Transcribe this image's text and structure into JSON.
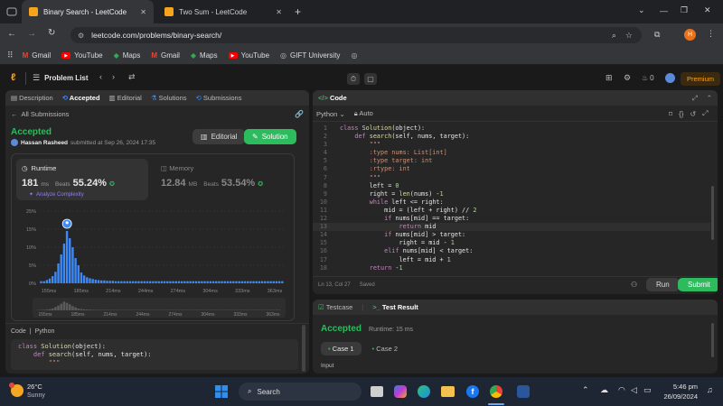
{
  "browser": {
    "tabs": [
      {
        "title": "Binary Search - LeetCode",
        "active": true
      },
      {
        "title": "Two Sum - LeetCode",
        "active": false
      }
    ],
    "url": "leetcode.com/problems/binary-search/",
    "profile_initial": "H",
    "bookmarks": [
      "Gmail",
      "YouTube",
      "Maps",
      "Gmail",
      "Maps",
      "YouTube",
      "GIFT University"
    ]
  },
  "nav": {
    "problem_list": "Problem List",
    "coins": "0",
    "premium": "Premium"
  },
  "left": {
    "tabs": [
      "Description",
      "Accepted",
      "Editorial",
      "Solutions",
      "Submissions"
    ],
    "all_submissions": "All Submissions",
    "status": "Accepted",
    "user": "Hassan Rasheed",
    "submitted": "submitted at Sep 26, 2024 17:35",
    "editorial_btn": "Editorial",
    "solution_btn": "Solution",
    "runtime": {
      "label": "Runtime",
      "value": "181",
      "unit": "ms",
      "beats_label": "Beats",
      "beats": "55.24%",
      "analyze": "Analyze Complexity"
    },
    "memory": {
      "label": "Memory",
      "value": "12.84",
      "unit": "MB",
      "beats_label": "Beats",
      "beats": "53.54%"
    },
    "code_label": "Code",
    "lang": "Python",
    "code_preview": [
      "class Solution(object):",
      "    def search(self, nums, target):",
      "        \"\"\""
    ]
  },
  "chart_data": {
    "type": "bar",
    "yticks": [
      "25%",
      "15%",
      "10%",
      "5%",
      "0%"
    ],
    "ylim": [
      0,
      25
    ],
    "xticks": [
      "155ms",
      "185ms",
      "214ms",
      "244ms",
      "274ms",
      "304ms",
      "333ms",
      "363ms"
    ],
    "values": [
      0.6,
      0.6,
      0.9,
      1.3,
      2,
      3.2,
      5.5,
      8,
      11,
      14.5,
      12.5,
      10,
      7,
      5,
      3,
      2.2,
      1.7,
      1.4,
      1.2,
      1,
      0.9,
      0.8,
      0.8,
      0.7,
      0.7,
      0.7,
      0.6,
      0.6,
      0.6,
      0.6,
      0.6,
      0.6,
      0.6,
      0.6,
      0.6,
      0.6,
      0.6,
      0.6,
      0.6,
      0.6,
      0.6,
      0.6,
      0.6,
      0.6,
      0.6,
      0.6,
      0.6,
      0.6,
      0.6,
      0.6,
      0.6,
      0.6,
      0.6,
      0.6,
      0.6,
      0.6,
      0.6,
      0.6,
      0.6,
      0.6,
      0.6,
      0.6,
      0.6,
      0.6,
      0.6,
      0.6,
      0.6,
      0.6,
      0.6,
      0.6,
      0.6,
      0.6,
      0.6,
      0.6,
      0.6,
      0.6,
      0.6,
      0.6,
      0.6,
      0.6,
      0.6,
      0.6,
      0.6,
      0.6,
      0.6
    ],
    "highlight_index": 9,
    "accent": "#3d8af7",
    "dim": "#2a5fae"
  },
  "editor": {
    "title": "Code",
    "lang": "Python",
    "mode": "Auto",
    "lines": [
      "class Solution(object):",
      "    def search(self, nums, target):",
      "        \"\"\"",
      "        :type nums: List[int]",
      "        :type target: int",
      "        :rtype: int",
      "        \"\"\"",
      "        left = 0",
      "        right = len(nums) -1",
      "        while left <= right:",
      "            mid = (left + right) // 2",
      "            if nums[mid] == target:",
      "                return mid",
      "            if nums[mid] > target:",
      "                right = mid - 1",
      "            elif nums[mid] < target:",
      "                left = mid + 1",
      "        return -1"
    ],
    "status": "Ln 13, Col 27",
    "saved": "Saved",
    "run": "Run",
    "submit": "Submit"
  },
  "test": {
    "tab1": "Testcase",
    "tab2": "Test Result",
    "status": "Accepted",
    "runtime": "Runtime: 15 ms",
    "case1": "Case 1",
    "case2": "Case 2",
    "input_label": "Input"
  },
  "taskbar": {
    "temp": "26°C",
    "weather": "Sunny",
    "search": "Search",
    "time": "5:46 pm",
    "date": "26/09/2024"
  }
}
